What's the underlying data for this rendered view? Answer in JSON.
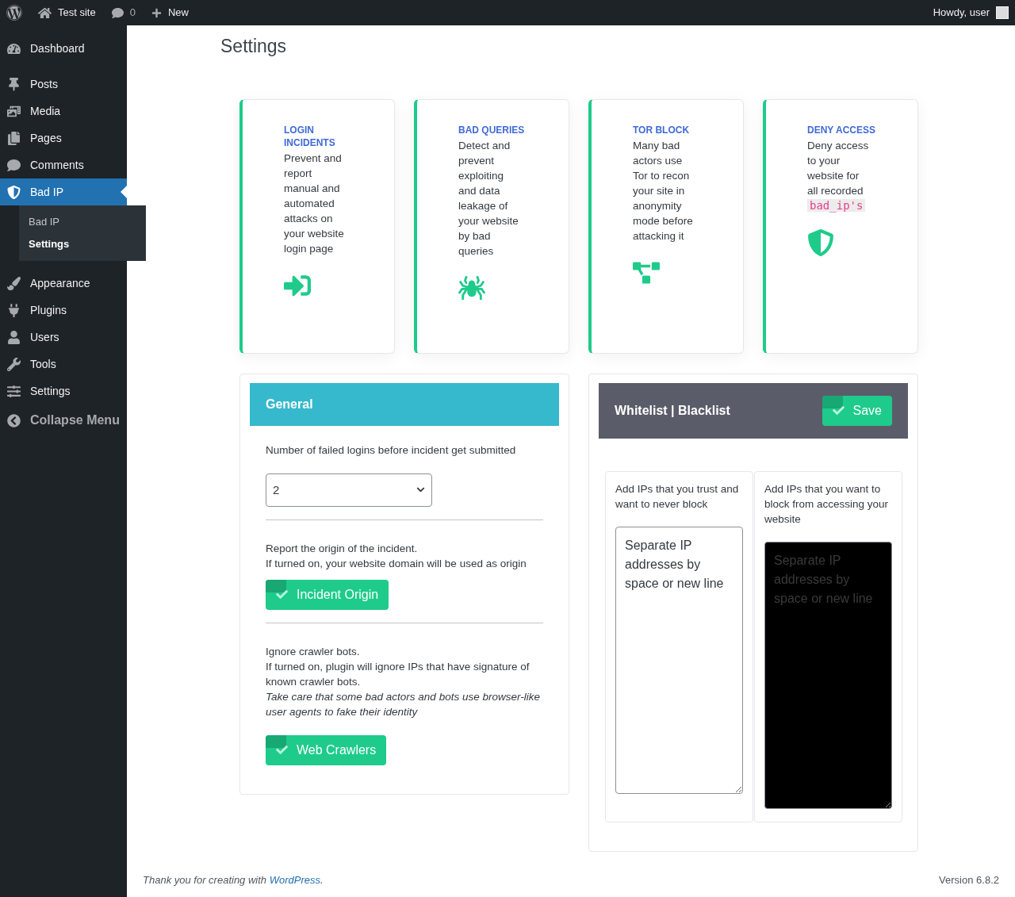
{
  "admin_bar": {
    "site": "Test site",
    "comments": "0",
    "new": "New",
    "greeting": "Howdy, user"
  },
  "sidebar": {
    "items": [
      {
        "label": "Dashboard",
        "selected": false
      },
      {
        "label": "Posts",
        "selected": false
      },
      {
        "label": "Media",
        "selected": false
      },
      {
        "label": "Pages",
        "selected": false
      },
      {
        "label": "Comments",
        "selected": false
      },
      {
        "label": "Bad IP",
        "selected": true,
        "children": [
          {
            "label": "Bad IP",
            "selected": false
          },
          {
            "label": "Settings",
            "selected": true
          }
        ]
      },
      {
        "label": "Appearance",
        "selected": false
      },
      {
        "label": "Plugins",
        "selected": false
      },
      {
        "label": "Users",
        "selected": false
      },
      {
        "label": "Tools",
        "selected": false
      },
      {
        "label": "Settings",
        "selected": false
      }
    ],
    "collapse": "Collapse Menu"
  },
  "page_title": "Settings",
  "features": [
    {
      "title": "LOGIN INCIDENTS",
      "text": "Prevent and report manual and automated attacks on your website login page"
    },
    {
      "title": "BAD QUERIES",
      "text": "Detect and prevent exploiting and data leakage of your website by bad queries"
    },
    {
      "title": "TOR BLOCK",
      "text": "Many bad actors use Tor to recon your site in anonymity mode before attacking it"
    },
    {
      "title": "DENY ACCESS",
      "text": "Deny access to your website for all recorded",
      "code": "bad_ip's"
    }
  ],
  "general": {
    "title": "General",
    "failed_logins": {
      "label": "Number of failed logins before incident get submitted",
      "value": "2"
    },
    "origin": {
      "lines": [
        "Report the origin of the incident.",
        "If turned on, your website domain will be used as origin"
      ],
      "toggle": {
        "label": "Incident Origin",
        "on": true
      }
    },
    "crawlers": {
      "lines": [
        "Ignore crawler bots.",
        "If turned on, plugin will ignore IPs that have signature of known crawler bots."
      ],
      "note": "Take care that some bad actors and bots use browser-like user agents to fake their identity",
      "toggle": {
        "label": "Web Crawlers",
        "on": true
      }
    }
  },
  "lists": {
    "title": "Whitelist | Blacklist",
    "save": "Save",
    "columns": [
      {
        "label": "Add IPs that you trust and want to never block",
        "placeholder": "Separate IP addresses by space or new line",
        "dark": false
      },
      {
        "label": "Add IPs that you want to block from accessing your website",
        "placeholder": "Separate IP addresses by space or new line",
        "dark": true
      }
    ]
  },
  "footer": {
    "thanks": "Thank you for creating with",
    "link": "WordPress",
    "end": ".",
    "version": "Version 6.8.2"
  }
}
